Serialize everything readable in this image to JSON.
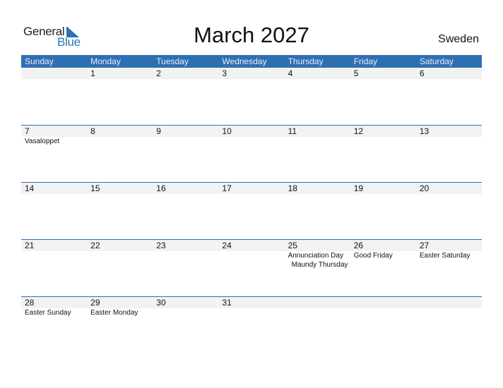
{
  "logo": {
    "general": "General",
    "blue": "Blue"
  },
  "title": "March 2027",
  "country": "Sweden",
  "colors": {
    "header_bg": "#2e6fb2",
    "row_bg": "#f2f2f2",
    "brand": "#2a72b8"
  },
  "days": [
    "Sunday",
    "Monday",
    "Tuesday",
    "Wednesday",
    "Thursday",
    "Friday",
    "Saturday"
  ],
  "weeks": [
    {
      "nums": [
        "",
        "1",
        "2",
        "3",
        "4",
        "5",
        "6"
      ],
      "events": [
        [],
        [],
        [],
        [],
        [],
        [],
        []
      ]
    },
    {
      "nums": [
        "7",
        "8",
        "9",
        "10",
        "11",
        "12",
        "13"
      ],
      "events": [
        [
          "Vasaloppet"
        ],
        [],
        [],
        [],
        [],
        [],
        []
      ]
    },
    {
      "nums": [
        "14",
        "15",
        "16",
        "17",
        "18",
        "19",
        "20"
      ],
      "events": [
        [],
        [],
        [],
        [],
        [],
        [],
        []
      ]
    },
    {
      "nums": [
        "21",
        "22",
        "23",
        "24",
        "25",
        "26",
        "27"
      ],
      "events": [
        [],
        [],
        [],
        [],
        [
          "Annunciation Day",
          "Maundy Thursday"
        ],
        [
          "Good Friday"
        ],
        [
          "Easter Saturday"
        ]
      ]
    },
    {
      "nums": [
        "28",
        "29",
        "30",
        "31",
        "",
        "",
        ""
      ],
      "events": [
        [
          "Easter Sunday"
        ],
        [
          "Easter Monday"
        ],
        [],
        [],
        [],
        [],
        []
      ]
    }
  ]
}
